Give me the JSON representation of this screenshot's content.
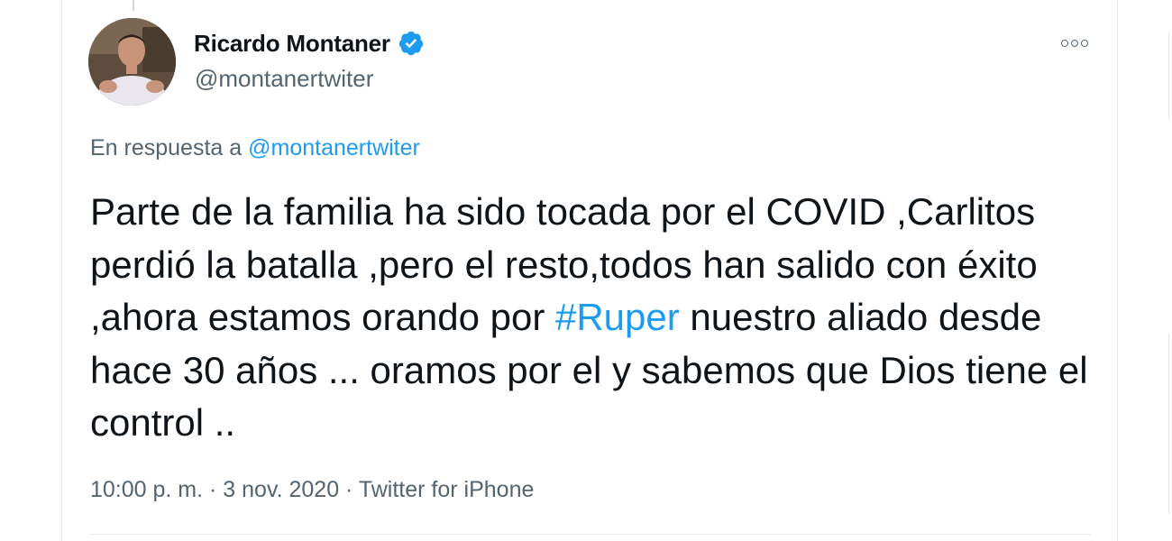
{
  "tweet": {
    "author": {
      "display_name": "Ricardo Montaner",
      "handle": "@montanertwiter",
      "verified": true
    },
    "reply": {
      "prefix": "En respuesta a ",
      "mention": "@montanertwiter"
    },
    "text": {
      "before_hashtag": "Parte de la familia ha sido tocada por el COVID ,Carlitos perdió la batalla ,pero el resto,todos han salido con éxito ,ahora estamos orando por ",
      "hashtag": "#Ruper",
      "after_hashtag": " nuestro aliado desde hace 30 años ... oramos por el y sabemos que Dios tiene el control .."
    },
    "meta": "10:00 p. m. · 3 nov. 2020 · Twitter for iPhone"
  },
  "colors": {
    "accent": "#1d9bf0",
    "secondary_text": "#536471",
    "primary_text": "#0f1419",
    "border": "#e6ecf0"
  },
  "icons": {
    "verified": "verified-badge-icon",
    "more": "more-options-icon"
  }
}
